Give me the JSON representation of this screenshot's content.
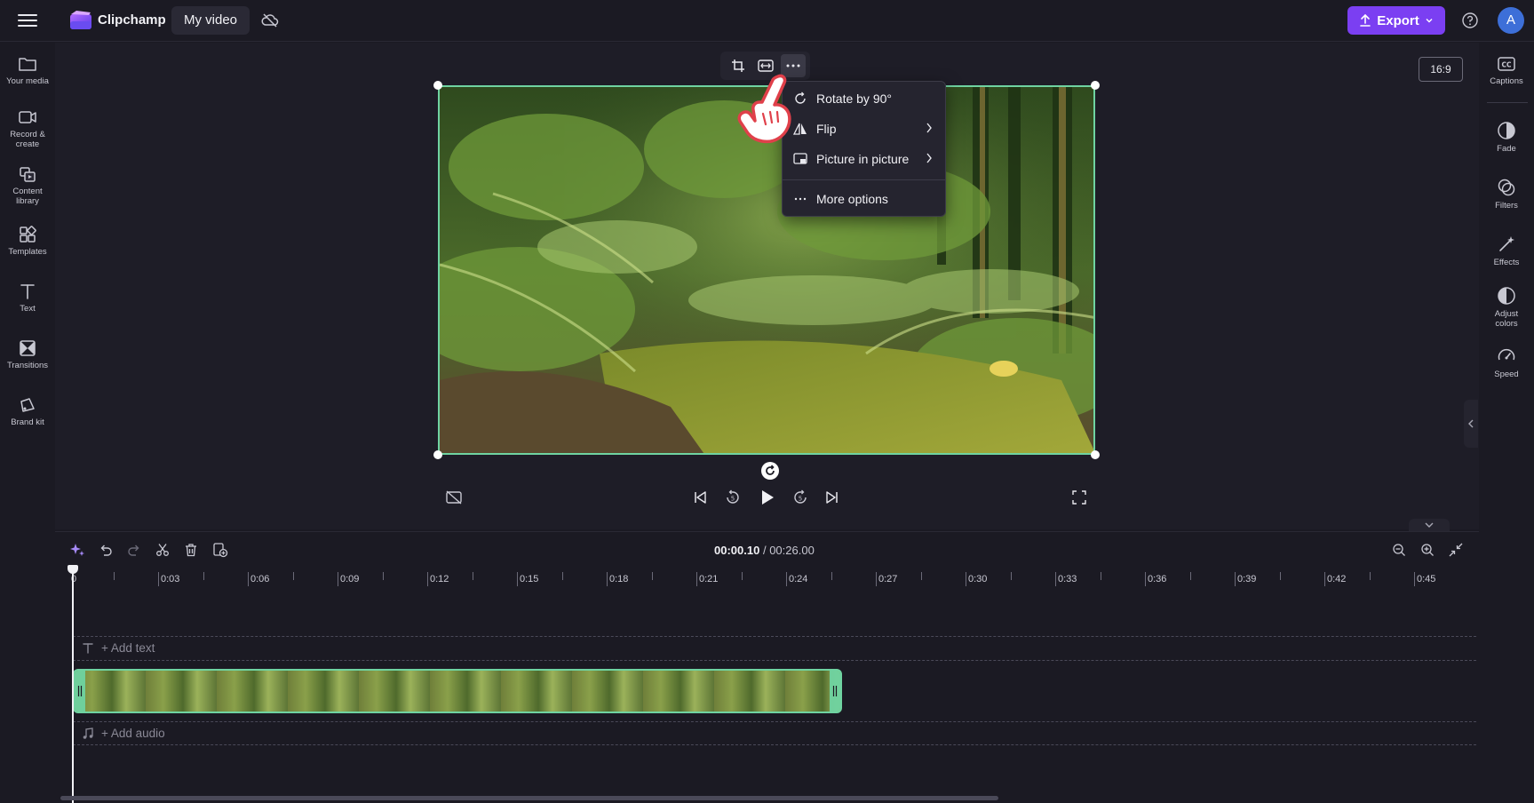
{
  "app": {
    "name": "Clipchamp",
    "project_name": "My video"
  },
  "header": {
    "export_label": "Export",
    "avatar_initial": "A"
  },
  "colors": {
    "accent": "#7b3ff2",
    "selection": "#6fd3a1"
  },
  "left_sidebar": {
    "items": [
      {
        "label": "Your media",
        "icon": "folder-icon"
      },
      {
        "label": "Record &",
        "label2": "create",
        "icon": "camera-icon"
      },
      {
        "label": "Content",
        "label2": "library",
        "icon": "library-icon"
      },
      {
        "label": "Templates",
        "icon": "templates-icon"
      },
      {
        "label": "Text",
        "icon": "text-icon"
      },
      {
        "label": "Transitions",
        "icon": "transitions-icon"
      },
      {
        "label": "Brand kit",
        "icon": "brand-kit-icon"
      }
    ]
  },
  "right_sidebar": {
    "items": [
      {
        "label": "Captions",
        "icon": "captions-icon"
      },
      {
        "label": "Fade",
        "icon": "fade-icon"
      },
      {
        "label": "Filters",
        "icon": "filters-icon"
      },
      {
        "label": "Effects",
        "icon": "effects-icon"
      },
      {
        "label": "Adjust",
        "label2": "colors",
        "icon": "adjust-colors-icon"
      },
      {
        "label": "Speed",
        "icon": "speed-icon"
      }
    ]
  },
  "preview": {
    "aspect_ratio": "16:9",
    "context_menu": [
      {
        "label": "Rotate by 90°",
        "icon": "rotate-icon"
      },
      {
        "label": "Flip",
        "icon": "flip-icon",
        "submenu": true
      },
      {
        "label": "Picture in picture",
        "icon": "pip-icon",
        "submenu": true
      },
      {
        "label": "More options",
        "icon": "more-icon"
      }
    ]
  },
  "timeline": {
    "current_time": "00:00.10",
    "separator": "/",
    "total_time": "00:26.00",
    "ticks": [
      "0",
      "0:03",
      "0:06",
      "0:09",
      "0:12",
      "0:15",
      "0:18",
      "0:21",
      "0:24",
      "0:27",
      "0:30",
      "0:33",
      "0:36",
      "0:39",
      "0:42",
      "0:45"
    ],
    "add_text_label": "+ Add text",
    "add_audio_label": "+ Add audio"
  }
}
